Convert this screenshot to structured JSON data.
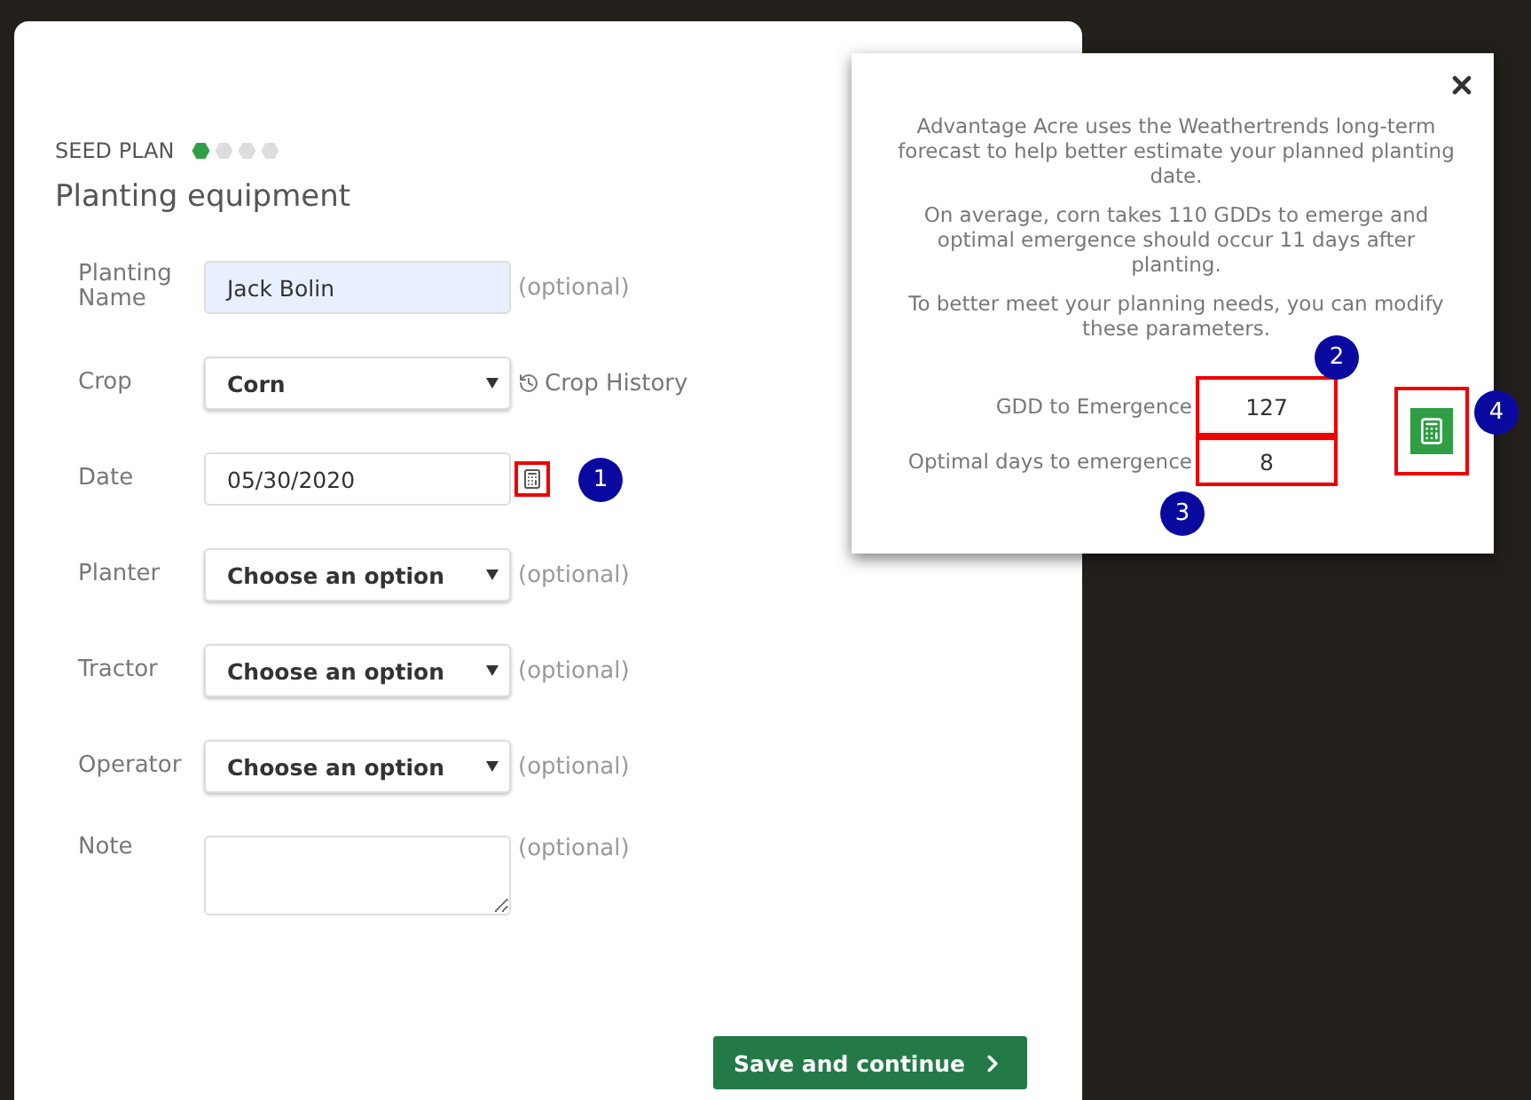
{
  "header": {
    "eyebrow": "SEED PLAN",
    "steps": [
      {
        "selected": true
      },
      {
        "selected": false
      },
      {
        "selected": false
      },
      {
        "selected": false
      }
    ],
    "title": "Planting equipment"
  },
  "fields": [
    {
      "kind": "text",
      "label": "Planting Name",
      "value": "Jack Bolin",
      "note": "(optional)"
    },
    {
      "kind": "select",
      "label": "Crop",
      "value": "Corn",
      "link": "Crop History"
    },
    {
      "kind": "date",
      "label": "Date",
      "value": "05/30/2020",
      "highlighted": true,
      "callout": "1"
    },
    {
      "kind": "select",
      "label": "Planter",
      "placeholder": "Choose an option",
      "note": "(optional)"
    },
    {
      "kind": "select",
      "label": "Tractor",
      "placeholder": "Choose an option",
      "note": "(optional)"
    },
    {
      "kind": "select",
      "label": "Operator",
      "placeholder": "Choose an option",
      "note": "(optional)"
    },
    {
      "kind": "textarea",
      "label": "Note",
      "note": "(optional)"
    }
  ],
  "save_button": "Save and continue",
  "popup": {
    "paragraphs": [
      "Advantage Acre uses the Weathertrends long-term forecast to help better estimate your planned planting date.",
      "On average, corn takes 110 GDDs to emerge and optimal emergence should occur 11 days after planting.",
      "To better meet your planning needs, you can modify these parameters."
    ],
    "params": [
      {
        "label": "GDD to Emergence",
        "value": "127",
        "highlighted": true,
        "callout": "2"
      },
      {
        "label": "Optimal days to emergence",
        "value": "8",
        "highlighted": true,
        "callout": "3"
      }
    ],
    "calculator": {
      "highlighted": true,
      "callout": "4"
    }
  }
}
